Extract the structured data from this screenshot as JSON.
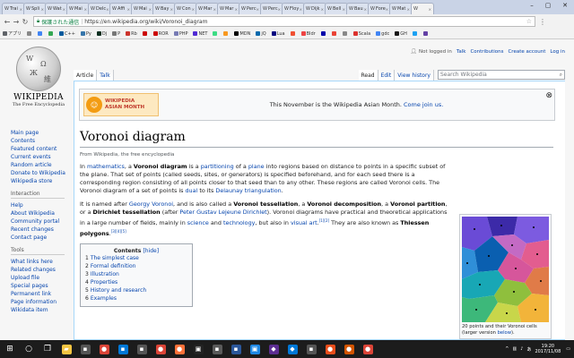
{
  "browser": {
    "tabs": [
      {
        "label": "Trai",
        "icon": "W",
        "active": false
      },
      {
        "label": "Spli",
        "icon": "W",
        "active": false
      },
      {
        "label": "Wat",
        "icon": "W",
        "active": false
      },
      {
        "label": "Mai",
        "icon": "W",
        "active": false
      },
      {
        "label": "Delc",
        "icon": "W",
        "active": false
      },
      {
        "label": "Affi",
        "icon": "W",
        "active": false
      },
      {
        "label": "Mai",
        "icon": "W",
        "active": false
      },
      {
        "label": "Bay",
        "icon": "W",
        "active": false
      },
      {
        "label": "Con",
        "icon": "W",
        "active": false
      },
      {
        "label": "Mar",
        "icon": "W",
        "active": false
      },
      {
        "label": "Mar",
        "icon": "W",
        "active": false
      },
      {
        "label": "Perc",
        "icon": "W",
        "active": false
      },
      {
        "label": "Perc",
        "icon": "W",
        "active": false
      },
      {
        "label": "Floy",
        "icon": "W",
        "active": false
      },
      {
        "label": "Dijk",
        "icon": "W",
        "active": false
      },
      {
        "label": "Bell",
        "icon": "W",
        "active": false
      },
      {
        "label": "Bau",
        "icon": "W",
        "active": false
      },
      {
        "label": "Fore",
        "icon": "W",
        "active": false
      },
      {
        "label": "Mat",
        "icon": "W",
        "active": false
      },
      {
        "label": "",
        "icon": "W",
        "active": true
      }
    ],
    "secure_label": "保護された通信",
    "url": "https://en.wikipedia.org/wiki/Voronoi_diagram",
    "bookmarks": [
      {
        "label": "アプリ",
        "color": "#5f6368"
      },
      {
        "label": "",
        "color": "#888"
      },
      {
        "label": "",
        "color": "#4285f4"
      },
      {
        "label": "",
        "color": "#34a853"
      },
      {
        "label": "C++",
        "color": "#00599c"
      },
      {
        "label": "Py",
        "color": "#3776ab"
      },
      {
        "label": "Dj",
        "color": "#092e20"
      },
      {
        "label": "P",
        "color": "#777"
      },
      {
        "label": "Rb",
        "color": "#cc342d"
      },
      {
        "label": "",
        "color": "#c00"
      },
      {
        "label": "ROR",
        "color": "#cc0000"
      },
      {
        "label": "PHP",
        "color": "#777bb4"
      },
      {
        "label": "NET",
        "color": "#512bd4"
      },
      {
        "label": "",
        "color": "#3ddc84"
      },
      {
        "label": "",
        "color": "#f89820"
      },
      {
        "label": "MDN",
        "color": "#000"
      },
      {
        "label": "jQ",
        "color": "#0769ad"
      },
      {
        "label": "Lua",
        "color": "#000080"
      },
      {
        "label": "",
        "color": "#f05032"
      },
      {
        "label": "Bldr",
        "color": "#e44"
      },
      {
        "label": "",
        "color": "#00a"
      },
      {
        "label": "",
        "color": "#ea4335"
      },
      {
        "label": "",
        "color": "#888"
      },
      {
        "label": "Scala",
        "color": "#dc322f"
      },
      {
        "label": "gdc",
        "color": "#4285f4"
      },
      {
        "label": "GH",
        "color": "#181717"
      },
      {
        "label": "",
        "color": "#1da1f2"
      },
      {
        "label": "",
        "color": "#6441a5"
      }
    ]
  },
  "wiki": {
    "logo_word": "WIKIPEDIA",
    "logo_tagline": "The Free Encyclopedia",
    "personal": {
      "not_logged_in": "Not logged in",
      "talk": "Talk",
      "contributions": "Contributions",
      "create_account": "Create account",
      "log_in": "Log in"
    },
    "tabs": {
      "article": "Article",
      "talk": "Talk",
      "read": "Read",
      "edit": "Edit",
      "view_history": "View history"
    },
    "search_placeholder": "Search Wikipedia",
    "sidebar": {
      "nav": [
        "Main page",
        "Contents",
        "Featured content",
        "Current events",
        "Random article",
        "Donate to Wikipedia",
        "Wikipedia store"
      ],
      "interaction_header": "Interaction",
      "interaction": [
        "Help",
        "About Wikipedia",
        "Community portal",
        "Recent changes",
        "Contact page"
      ],
      "tools_header": "Tools",
      "tools": [
        "What links here",
        "Related changes",
        "Upload file",
        "Special pages",
        "Permanent link",
        "Page information",
        "Wikidata item"
      ]
    },
    "banner": {
      "logo_line1": "WIKIPEDIA",
      "logo_line2": "ASIAN MONTH",
      "text": "This November is the Wikipedia Asian Month.",
      "link": "Come join us."
    },
    "title": "Voronoi diagram",
    "subtitle": "From Wikipedia, the free encyclopedia",
    "paragraph1": {
      "t1": "In ",
      "l1": "mathematics",
      "t2": ", a ",
      "b1": "Voronoi diagram",
      "t3": " is a ",
      "l2": "partitioning",
      "t4": " of a ",
      "l3": "plane",
      "t5": " into regions based on distance to points in a specific subset of the plane. That set of points (called seeds, sites, or generators) is specified beforehand, and for each seed there is a corresponding region consisting of all points closer to that seed than to any other. These regions are called Voronoi cells. The Voronoi diagram of a set of points is ",
      "l4": "dual",
      "t6": " to its ",
      "l5": "Delaunay triangulation",
      "t7": "."
    },
    "paragraph2": {
      "t1": "It is named after ",
      "l1": "Georgy Voronoi",
      "t2": ", and is also called a ",
      "b1": "Voronoi tessellation",
      "t3": ", a ",
      "b2": "Voronoi decomposition",
      "t4": ", a ",
      "b3": "Voronoi partition",
      "t5": ", or a ",
      "b4": "Dirichlet tessellation",
      "t6": " (after ",
      "l2": "Peter Gustav Lejeune Dirichlet",
      "t7": "). Voronoi diagrams have practical and theoretical applications in a large number of fields, mainly in ",
      "l3": "science",
      "t8": " and ",
      "l4": "technology",
      "t9": ", but also in ",
      "l5": "visual art",
      "t10": ".",
      "sup1": "[1][2]",
      "t11": " They are also known as ",
      "b5": "Thiessen polygons",
      "t12": ".",
      "sup2": "[3][4][5]"
    },
    "thumb_caption": {
      "t1": "20 points and their Voronoi cells (larger version ",
      "l1": "below",
      "t2": ")."
    },
    "toc": {
      "title": "Contents",
      "hide": "[hide]",
      "items": [
        {
          "num": "1",
          "label": "The simplest case"
        },
        {
          "num": "2",
          "label": "Formal definition"
        },
        {
          "num": "3",
          "label": "Illustration"
        },
        {
          "num": "4",
          "label": "Properties"
        },
        {
          "num": "5",
          "label": "History and research"
        },
        {
          "num": "6",
          "label": "Examples"
        }
      ]
    }
  },
  "taskbar": {
    "apps": [
      {
        "name": "file-explorer-icon",
        "color": "#f4c542",
        "glyph": "▰"
      },
      {
        "name": "app-icon-2",
        "color": "#555",
        "glyph": "▪"
      },
      {
        "name": "chrome-icon",
        "color": "#db4437",
        "glyph": "●"
      },
      {
        "name": "app-icon-4",
        "color": "#0078d7",
        "glyph": "▪"
      },
      {
        "name": "app-icon-5",
        "color": "#555",
        "glyph": "▪"
      },
      {
        "name": "chrome-icon-2",
        "color": "#db4437",
        "glyph": "●"
      },
      {
        "name": "firefox-icon",
        "color": "#ff7139",
        "glyph": "●"
      },
      {
        "name": "terminal-icon",
        "color": "#222",
        "glyph": "▣"
      },
      {
        "name": "app-icon-9",
        "color": "#5a5a5a",
        "glyph": "▪"
      },
      {
        "name": "app-icon-10",
        "color": "#2b579a",
        "glyph": "▪"
      },
      {
        "name": "app-icon-11",
        "color": "#1e88e5",
        "glyph": "▣"
      },
      {
        "name": "visual-studio-icon",
        "color": "#5c2d91",
        "glyph": "◆"
      },
      {
        "name": "app-icon-13",
        "color": "#0078d7",
        "glyph": "◆"
      },
      {
        "name": "app-icon-14",
        "color": "#555",
        "glyph": "▪"
      },
      {
        "name": "app-icon-15",
        "color": "#e94e1b",
        "glyph": "●"
      },
      {
        "name": "app-icon-16",
        "color": "#d35400",
        "glyph": "●"
      },
      {
        "name": "chrome-icon-3",
        "color": "#db4437",
        "glyph": "●"
      }
    ],
    "time": "19:20",
    "date": "2017/11/08"
  }
}
